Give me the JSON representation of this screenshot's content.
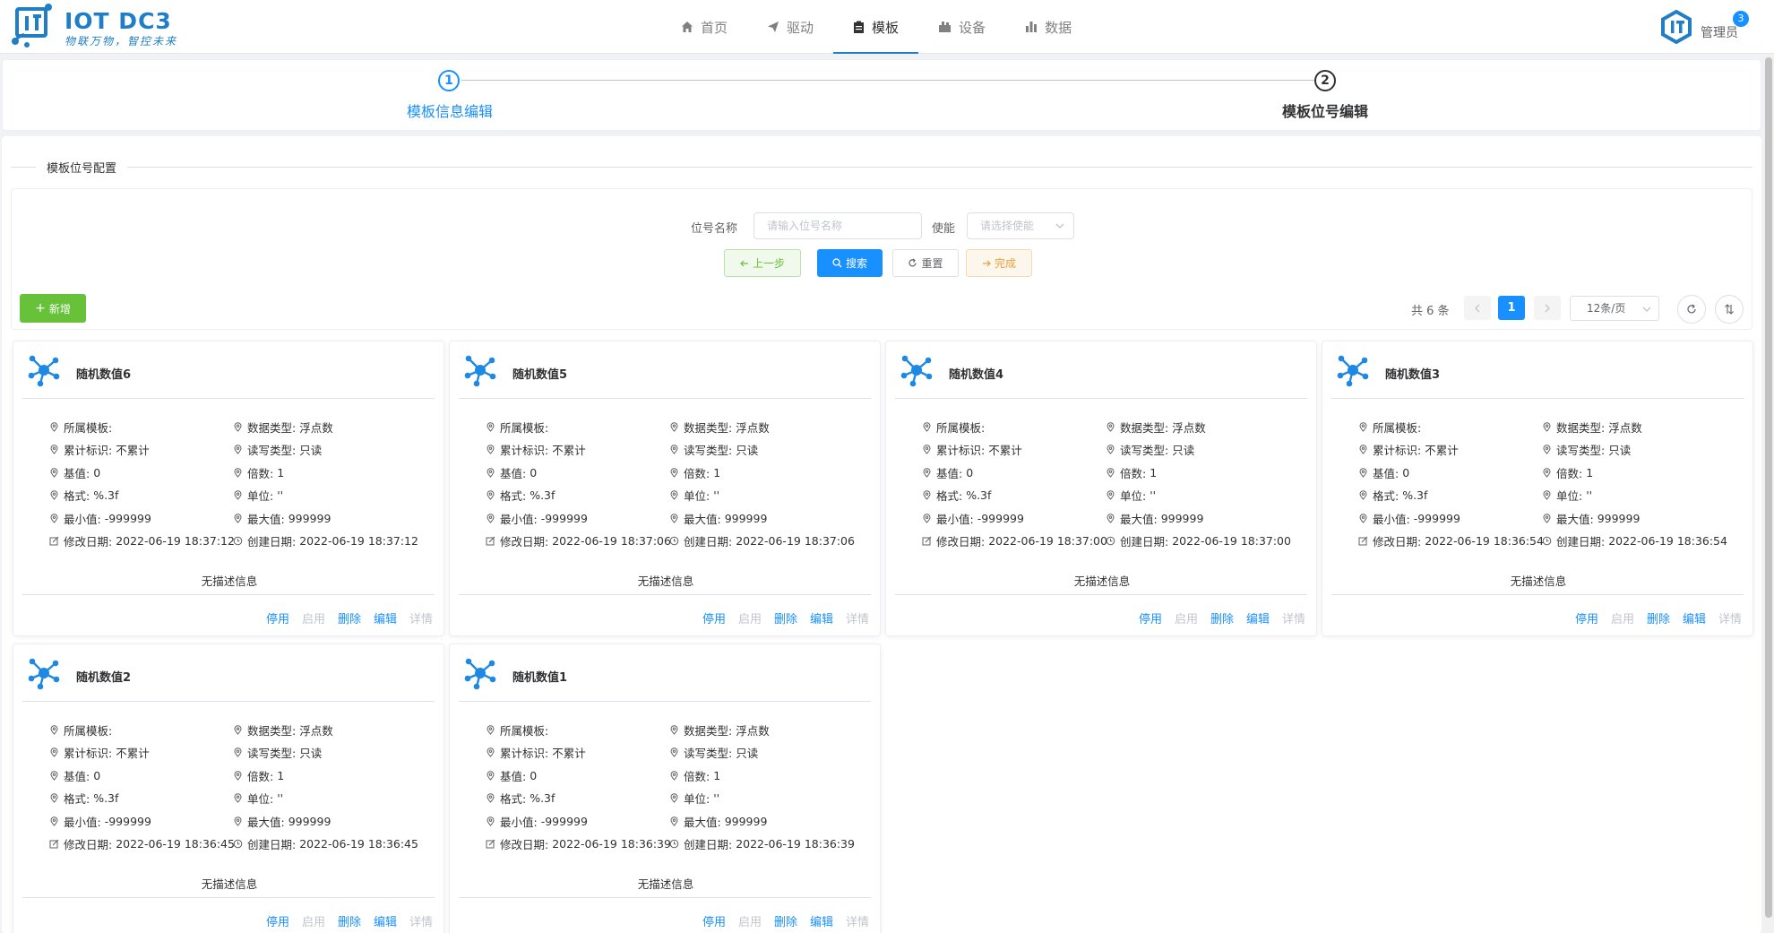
{
  "header": {
    "logo_title": "IOT DC3",
    "logo_slogan": "物联万物，智控未来",
    "nav": [
      {
        "label": "首页",
        "icon": "home-icon"
      },
      {
        "label": "驱动",
        "icon": "send-icon"
      },
      {
        "label": "模板",
        "icon": "clipboard-icon",
        "active": true
      },
      {
        "label": "设备",
        "icon": "device-icon"
      },
      {
        "label": "数据",
        "icon": "bar-chart-icon"
      }
    ],
    "user_name": "管理员",
    "badge_count": "3"
  },
  "steps": {
    "step1": {
      "number": "1",
      "title": "模板信息编辑"
    },
    "step2": {
      "number": "2",
      "title": "模板位号编辑"
    }
  },
  "section_title": "模板位号配置",
  "search": {
    "point_name_label": "位号名称",
    "point_name_placeholder": "请输入位号名称",
    "enable_label": "使能",
    "enable_placeholder": "请选择使能",
    "prev_label": "上一步",
    "search_label": "搜索",
    "reset_label": "重置",
    "finish_label": "完成"
  },
  "toolbar": {
    "add_label": "新增",
    "total_text": "共 6 条",
    "current_page": "1",
    "page_size": "12条/页"
  },
  "colors": {
    "brand": "#1f7ec5",
    "primary": "#1890ff",
    "success": "#67c23a",
    "warning": "#e6a23c"
  },
  "field_labels": {
    "template": "所属模板:",
    "data_type": "数据类型:",
    "accrue": "累计标识:",
    "rw": "读写类型:",
    "base": "基值:",
    "multiple": "倍数:",
    "format": "格式:",
    "unit": "单位:",
    "min": "最小值:",
    "max": "最大值:",
    "updated": "修改日期:",
    "created": "创建日期:"
  },
  "actions": [
    "停用",
    "启用",
    "删除",
    "编辑",
    "详情"
  ],
  "cards": [
    {
      "name": "随机数值6",
      "template": "",
      "data_type": "浮点数",
      "accrue": "不累计",
      "rw": "只读",
      "base": "0",
      "multiple": "1",
      "format": "%.3f",
      "unit": "''",
      "min": "-999999",
      "max": "999999",
      "updated": "2022-06-19 18:37:12",
      "created": "2022-06-19 18:37:12",
      "description": "无描述信息"
    },
    {
      "name": "随机数值5",
      "template": "",
      "data_type": "浮点数",
      "accrue": "不累计",
      "rw": "只读",
      "base": "0",
      "multiple": "1",
      "format": "%.3f",
      "unit": "''",
      "min": "-999999",
      "max": "999999",
      "updated": "2022-06-19 18:37:06",
      "created": "2022-06-19 18:37:06",
      "description": "无描述信息"
    },
    {
      "name": "随机数值4",
      "template": "",
      "data_type": "浮点数",
      "accrue": "不累计",
      "rw": "只读",
      "base": "0",
      "multiple": "1",
      "format": "%.3f",
      "unit": "''",
      "min": "-999999",
      "max": "999999",
      "updated": "2022-06-19 18:37:00",
      "created": "2022-06-19 18:37:00",
      "description": "无描述信息"
    },
    {
      "name": "随机数值3",
      "template": "",
      "data_type": "浮点数",
      "accrue": "不累计",
      "rw": "只读",
      "base": "0",
      "multiple": "1",
      "format": "%.3f",
      "unit": "''",
      "min": "-999999",
      "max": "999999",
      "updated": "2022-06-19 18:36:54",
      "created": "2022-06-19 18:36:54",
      "description": "无描述信息"
    },
    {
      "name": "随机数值2",
      "template": "",
      "data_type": "浮点数",
      "accrue": "不累计",
      "rw": "只读",
      "base": "0",
      "multiple": "1",
      "format": "%.3f",
      "unit": "''",
      "min": "-999999",
      "max": "999999",
      "updated": "2022-06-19 18:36:45",
      "created": "2022-06-19 18:36:45",
      "description": "无描述信息"
    },
    {
      "name": "随机数值1",
      "template": "",
      "data_type": "浮点数",
      "accrue": "不累计",
      "rw": "只读",
      "base": "0",
      "multiple": "1",
      "format": "%.3f",
      "unit": "''",
      "min": "-999999",
      "max": "999999",
      "updated": "2022-06-19 18:36:39",
      "created": "2022-06-19 18:36:39",
      "description": "无描述信息"
    }
  ]
}
